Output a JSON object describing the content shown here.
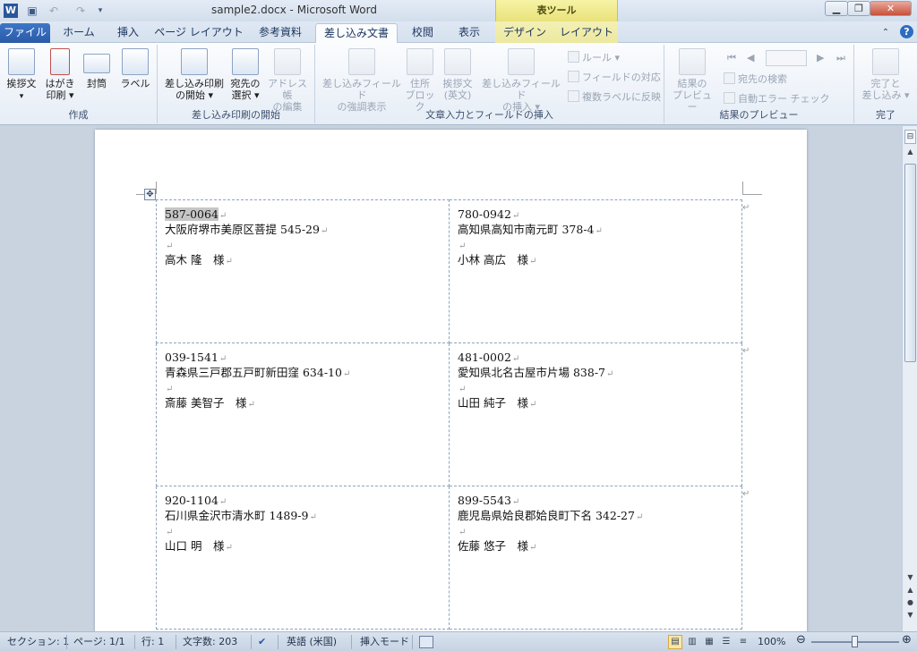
{
  "titlebar": {
    "app_icon_letter": "W",
    "title": "sample2.docx - Microsoft Word",
    "table_tools": "表ツール",
    "icons": [
      "save-icon",
      "undo-icon",
      "redo-icon",
      "customize-qat-icon"
    ]
  },
  "tabs": [
    {
      "label": "ファイル"
    },
    {
      "label": "ホーム"
    },
    {
      "label": "挿入"
    },
    {
      "label": "ページ レイアウト"
    },
    {
      "label": "参考資料"
    },
    {
      "label": "差し込み文書"
    },
    {
      "label": "校閲"
    },
    {
      "label": "表示"
    },
    {
      "label": "デザイン"
    },
    {
      "label": "レイアウト"
    }
  ],
  "ribbon": {
    "create": {
      "label": "作成",
      "greeting": "挨拶文",
      "postcard_1": "はがき",
      "postcard_2": "印刷",
      "envelope": "封筒",
      "labels": "ラベル"
    },
    "start": {
      "label": "差し込み印刷の開始",
      "start_1": "差し込み印刷",
      "start_2": "の開始",
      "select_1": "宛先の",
      "select_2": "選択",
      "edit_1": "アドレス帳",
      "edit_2": "の編集"
    },
    "write": {
      "label": "文章入力とフィールドの挿入",
      "highlight_1": "差し込みフィールド",
      "highlight_2": "の強調表示",
      "address_1": "住所",
      "address_2": "ブロック",
      "greeting_1": "挨拶文",
      "greeting_2": "(英文)",
      "insert_1": "差し込みフィールド",
      "insert_2": "の挿入",
      "rules": "ルール",
      "match": "フィールドの対応",
      "update": "複数ラベルに反映"
    },
    "preview": {
      "label": "結果のプレビュー",
      "preview_1": "結果の",
      "preview_2": "プレビュー",
      "find": "宛先の検索",
      "check": "自動エラー チェック"
    },
    "finish": {
      "label": "完了",
      "finish_1": "完了と",
      "finish_2": "差し込み"
    }
  },
  "labels": [
    {
      "zip": "587-0064",
      "addr": "大阪府堺市美原区菩提 545-29",
      "name": "高木 隆　様"
    },
    {
      "zip": "780-0942",
      "addr": "高知県高知市南元町 378-4",
      "name": "小林 高広　様"
    },
    {
      "zip": "039-1541",
      "addr": "青森県三戸郡五戸町新田窪 634-10",
      "name": "斎藤 美智子　様"
    },
    {
      "zip": "481-0002",
      "addr": "愛知県北名古屋市片場 838-7",
      "name": "山田 純子　様"
    },
    {
      "zip": "920-1104",
      "addr": "石川県金沢市清水町 1489-9",
      "name": "山口 明　様"
    },
    {
      "zip": "899-5543",
      "addr": "鹿児島県姶良郡姶良町下名 342-27",
      "name": "佐藤 悠子　様"
    }
  ],
  "marks": {
    "para": "↵"
  },
  "statusbar": {
    "section": "セクション: 1",
    "page": "ページ: 1/1",
    "line": "行: 1",
    "words": "文字数: 203",
    "language": "英語 (米国)",
    "mode": "挿入モード",
    "zoom": "100%",
    "zoom_level": 100
  }
}
